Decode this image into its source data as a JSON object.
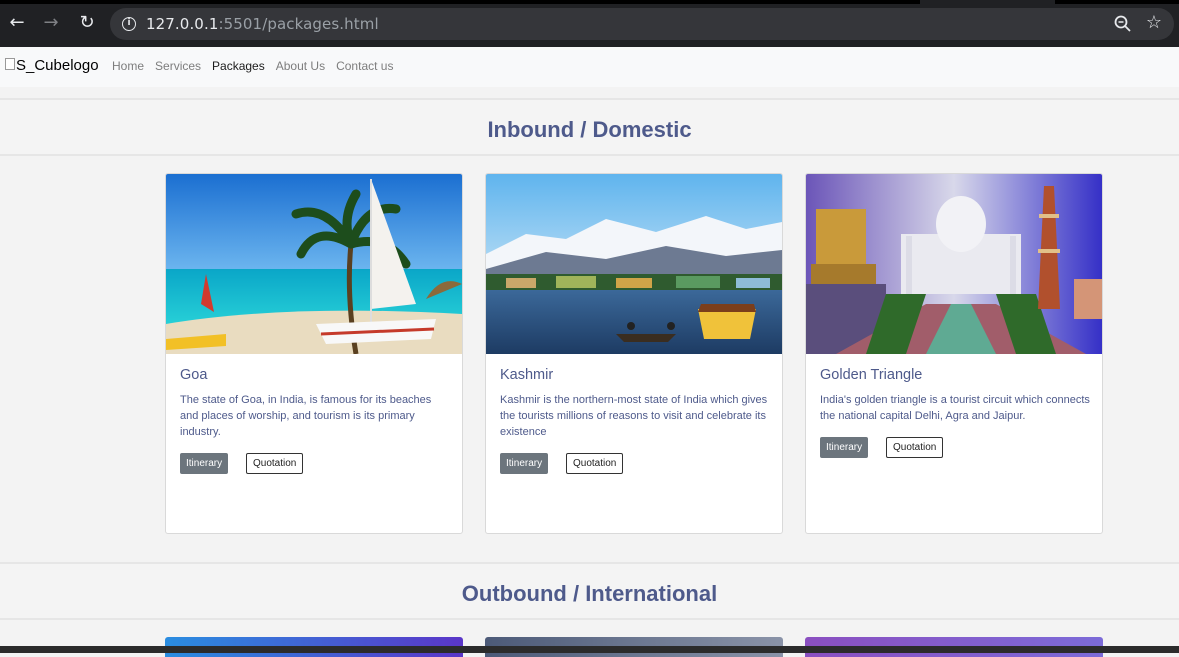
{
  "browser": {
    "url_host": "127.0.0.1",
    "url_rest": ":5501/packages.html"
  },
  "navbar": {
    "brand_alt": "S_Cubelogo",
    "links": [
      {
        "label": "Home",
        "active": false
      },
      {
        "label": "Services",
        "active": false
      },
      {
        "label": "Packages",
        "active": true
      },
      {
        "label": "About Us",
        "active": false
      },
      {
        "label": "Contact us",
        "active": false
      }
    ]
  },
  "sections": [
    {
      "title": "Inbound / Domestic",
      "cards": [
        {
          "title": "Goa",
          "description": "The state of Goa, in India, is famous for its beaches and places of worship, and tourism is its primary industry.",
          "itinerary_label": "Itinerary",
          "quotation_label": "Quotation",
          "image": "beach-palm-sailboat"
        },
        {
          "title": "Kashmir",
          "description": "Kashmir is the northern-most state of India which gives the tourists millions of reasons to visit and celebrate its existence",
          "itinerary_label": "Itinerary",
          "quotation_label": "Quotation",
          "image": "mountain-lake-boats"
        },
        {
          "title": "Golden Triangle",
          "description": "India's golden triangle is a tourist circuit which connects the national capital Delhi, Agra and Jaipur.",
          "itinerary_label": "Itinerary",
          "quotation_label": "Quotation",
          "image": "taj-mahal-monuments"
        }
      ]
    },
    {
      "title": "Outbound / International",
      "cards": []
    }
  ],
  "colors": {
    "heading": "#4e5a8b",
    "itinerary_btn": "#6c757d"
  }
}
